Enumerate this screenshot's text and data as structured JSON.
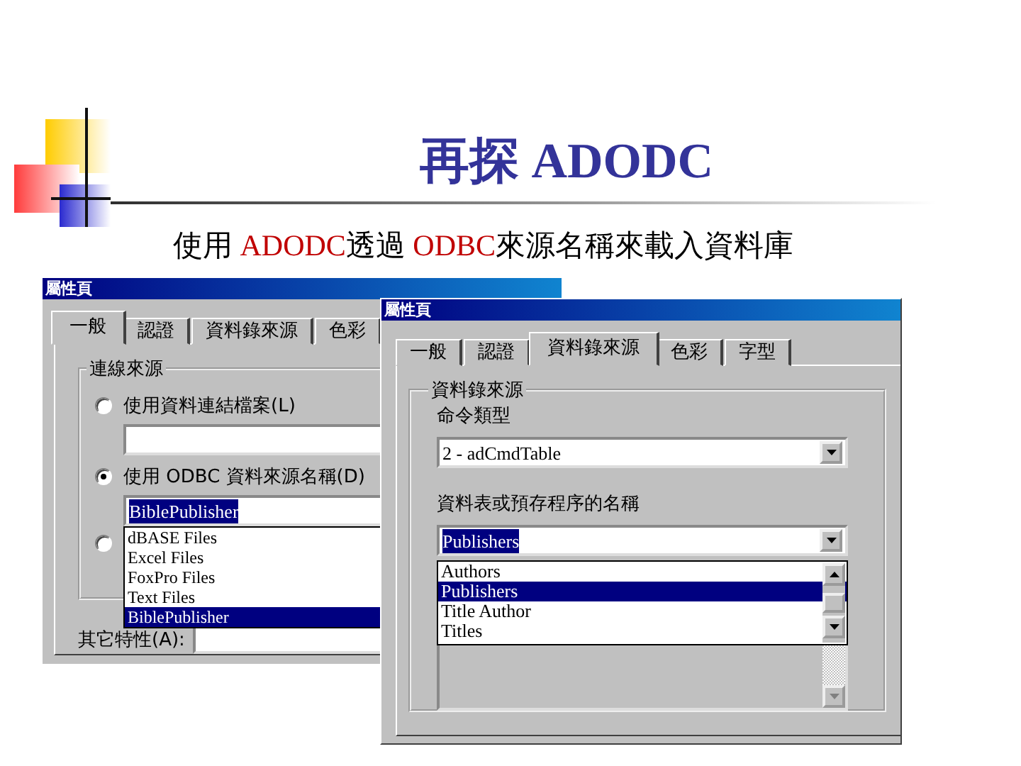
{
  "slide": {
    "title": "再探 ADODC",
    "subtitle": [
      {
        "text": "使用 ",
        "highlight": false
      },
      {
        "text": "ADODC",
        "highlight": true
      },
      {
        "text": "透過 ",
        "highlight": false
      },
      {
        "text": "ODBC",
        "highlight": true
      },
      {
        "text": "來源名稱來載入資料庫",
        "highlight": false
      }
    ]
  },
  "left_dialog": {
    "title": "屬性頁",
    "tabs": [
      {
        "label": "一般",
        "selected": true
      },
      {
        "label": "認證",
        "selected": false
      },
      {
        "label": "資料錄來源",
        "selected": false
      },
      {
        "label": "色彩",
        "selected": false
      }
    ],
    "group_label": "連線來源",
    "options": [
      {
        "label": "使用資料連結檔案(L)",
        "selected": false
      },
      {
        "label": "使用 ODBC 資料來源名稱(D)",
        "selected": true
      },
      {
        "selected": false
      }
    ],
    "dsn_combo": {
      "value": "BiblePublisher"
    },
    "dsn_list": [
      {
        "label": "dBASE Files",
        "selected": false
      },
      {
        "label": "Excel Files",
        "selected": false
      },
      {
        "label": "FoxPro Files",
        "selected": false
      },
      {
        "label": "Text Files",
        "selected": false
      },
      {
        "label": "BiblePublisher",
        "selected": true
      }
    ],
    "other_label": "其它特性(A):"
  },
  "right_dialog": {
    "title": "屬性頁",
    "tabs": [
      {
        "label": "一般",
        "selected": false
      },
      {
        "label": "認證",
        "selected": false
      },
      {
        "label": "資料錄來源",
        "selected": true
      },
      {
        "label": "色彩",
        "selected": false
      },
      {
        "label": "字型",
        "selected": false
      }
    ],
    "group_label": "資料錄來源",
    "command_label": "命令類型",
    "command_combo": {
      "value": "2 - adCmdTable"
    },
    "table_label": "資料表或預存程序的名稱",
    "table_combo": {
      "value": "Publishers"
    },
    "table_list": [
      {
        "label": "Authors",
        "selected": false
      },
      {
        "label": "Publishers",
        "selected": true
      },
      {
        "label": "Title Author",
        "selected": false
      },
      {
        "label": "Titles",
        "selected": false
      }
    ]
  }
}
